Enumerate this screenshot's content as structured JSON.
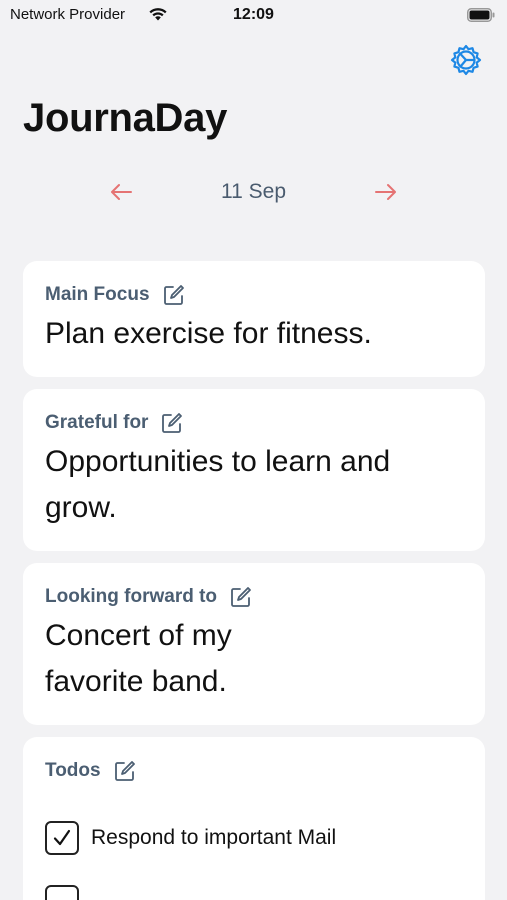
{
  "status_bar": {
    "carrier": "Network Provider",
    "time": "12:09"
  },
  "app": {
    "title": "JournaDay",
    "accent_color": "#1e88e5",
    "arrow_color": "#e57373"
  },
  "date_nav": {
    "date": "11 Sep",
    "prev_icon": "arrow-left-icon",
    "next_icon": "arrow-right-icon"
  },
  "cards": {
    "main_focus": {
      "label": "Main Focus",
      "text": "Plan exercise for fitness."
    },
    "grateful": {
      "label": "Grateful for",
      "text": "Opportunities to learn and grow."
    },
    "looking_forward": {
      "label": "Looking forward to",
      "text": "Concert of my favorite band."
    },
    "todos": {
      "label": "Todos",
      "items": [
        {
          "text": "Respond to important Mail",
          "checked": true
        }
      ]
    }
  }
}
